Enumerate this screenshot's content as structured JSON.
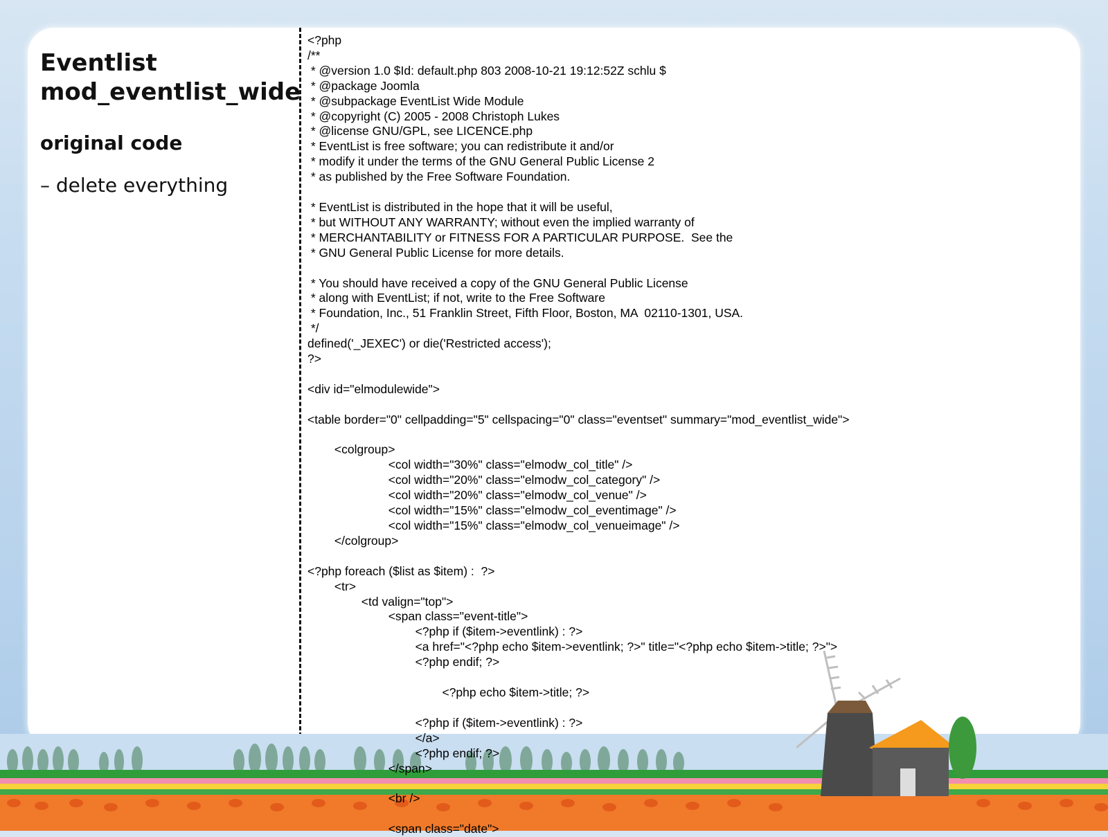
{
  "slide": {
    "title_line1": "Eventlist",
    "title_line2": "mod_eventlist_wide",
    "subtitle": "original code",
    "bullet": "– delete everything",
    "code": "<?php\n/**\n * @version 1.0 $Id: default.php 803 2008-10-21 19:12:52Z schlu $\n * @package Joomla\n * @subpackage EventList Wide Module\n * @copyright (C) 2005 - 2008 Christoph Lukes\n * @license GNU/GPL, see LICENCE.php\n * EventList is free software; you can redistribute it and/or\n * modify it under the terms of the GNU General Public License 2\n * as published by the Free Software Foundation.\n\n * EventList is distributed in the hope that it will be useful,\n * but WITHOUT ANY WARRANTY; without even the implied warranty of\n * MERCHANTABILITY or FITNESS FOR A PARTICULAR PURPOSE.  See the\n * GNU General Public License for more details.\n\n * You should have received a copy of the GNU General Public License\n * along with EventList; if not, write to the Free Software\n * Foundation, Inc., 51 Franklin Street, Fifth Floor, Boston, MA  02110-1301, USA.\n */\ndefined('_JEXEC') or die('Restricted access');\n?>\n\n<div id=\"elmodulewide\">\n\n<table border=\"0\" cellpadding=\"5\" cellspacing=\"0\" class=\"eventset\" summary=\"mod_eventlist_wide\">\n\n        <colgroup>\n                        <col width=\"30%\" class=\"elmodw_col_title\" />\n                        <col width=\"20%\" class=\"elmodw_col_category\" />\n                        <col width=\"20%\" class=\"elmodw_col_venue\" />\n                        <col width=\"15%\" class=\"elmodw_col_eventimage\" />\n                        <col width=\"15%\" class=\"elmodw_col_venueimage\" />\n        </colgroup>\n\n<?php foreach ($list as $item) :  ?>\n        <tr>\n                <td valign=\"top\">\n                        <span class=\"event-title\">\n                                <?php if ($item->eventlink) : ?>\n                                <a href=\"<?php echo $item->eventlink; ?>\" title=\"<?php echo $item->title; ?>\">\n                                <?php endif; ?>\n\n                                        <?php echo $item->title; ?>\n\n                                <?php if ($item->eventlink) : ?>\n                                </a>\n                                <?php endif; ?>\n                        </span>\n\n                        <br />\n\n                        <span class=\"date\">"
  },
  "colors": {
    "sky": "#c6dcf0",
    "card": "#ffffff",
    "grass": "#2f9e3a",
    "tulips": "#f07a2a",
    "roof": "#f59a1c"
  }
}
